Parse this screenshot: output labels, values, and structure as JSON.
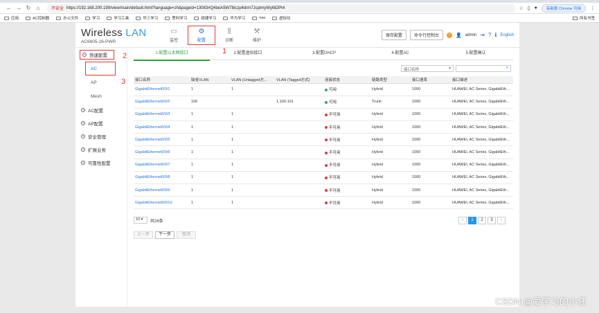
{
  "browser": {
    "insecure_label": "不安全",
    "url": "https://192.168.200.199/view/main/default.html?language=zh&pageid=13083#Q4beA5W78iczp4drm7JcpimyWyt6DPt4",
    "update_label": "有新版 Chrome 可用",
    "bookmarks": [
      "应用",
      "AC控制器",
      "办公文件",
      "学习",
      "学习工具",
      "华三学习",
      "思科学习",
      "锐捷学习",
      "华为学习",
      "nas",
      "虚拟化"
    ],
    "all_bookmarks": "所有书签"
  },
  "brand": {
    "word1": "Wireless",
    "word2": "LAN",
    "model": "AC6605-26-PWR"
  },
  "nav": [
    {
      "label": "监控",
      "icon": "monitor-icon"
    },
    {
      "label": "配置",
      "icon": "gear-icon"
    },
    {
      "label": "诊断",
      "icon": "diagnose-icon"
    },
    {
      "label": "维护",
      "icon": "maintain-icon"
    }
  ],
  "header": {
    "save": "保存配置",
    "cli": "命令行控制台",
    "user": "admin",
    "lang": "English"
  },
  "sidebar": {
    "quick": "快速配置",
    "sub": [
      "AC",
      "AP",
      "Mesh"
    ],
    "items": [
      "AC配置",
      "AP配置",
      "安全管理",
      "扩展业务",
      "可靠性配置"
    ]
  },
  "annotations": [
    "1",
    "2",
    "3"
  ],
  "steps": [
    "1.配置以太网接口",
    "2.配置虚拟接口",
    "3.配置DHCP",
    "4.配置AC",
    "5.配置确认"
  ],
  "filter": {
    "select": "接口名称",
    "search_icon": "search-icon"
  },
  "table": {
    "headers": [
      "接口名称",
      "缺省VLAN",
      "VLAN (Untagged方...",
      "VLAN (Tagged方式)",
      "连接状态",
      "链路类型",
      "接口速率",
      "接口描述"
    ],
    "rows": [
      [
        "GigabitEthernet0/0/1",
        "1",
        "1",
        "",
        "可用",
        "Hybrid",
        "1000",
        "HUAWEI, AC Series, GigabitEth..."
      ],
      [
        "GigabitEthernet0/0/2",
        "100",
        "",
        "1,100-101",
        "可用",
        "Trunk",
        "1000",
        "HUAWEI, AC Series, GigabitEth..."
      ],
      [
        "GigabitEthernet0/0/3",
        "1",
        "1",
        "",
        "不可用",
        "Hybrid",
        "1000",
        "HUAWEI, AC Series, GigabitEth..."
      ],
      [
        "GigabitEthernet0/0/4",
        "1",
        "1",
        "",
        "不可用",
        "Hybrid",
        "1000",
        "HUAWEI, AC Series, GigabitEth..."
      ],
      [
        "GigabitEthernet0/0/5",
        "1",
        "1",
        "",
        "不可用",
        "Hybrid",
        "1000",
        "HUAWEI, AC Series, GigabitEth..."
      ],
      [
        "GigabitEthernet0/0/6",
        "1",
        "1",
        "",
        "不可用",
        "Hybrid",
        "1000",
        "HUAWEI, AC Series, GigabitEth..."
      ],
      [
        "GigabitEthernet0/0/7",
        "1",
        "1",
        "",
        "不可用",
        "Hybrid",
        "1000",
        "HUAWEI, AC Series, GigabitEth..."
      ],
      [
        "GigabitEthernet0/0/8",
        "1",
        "1",
        "",
        "不可用",
        "Hybrid",
        "1000",
        "HUAWEI, AC Series, GigabitEth..."
      ],
      [
        "GigabitEthernet0/0/9",
        "1",
        "1",
        "",
        "不可用",
        "Hybrid",
        "1000",
        "HUAWEI, AC Series, GigabitEth..."
      ],
      [
        "GigabitEthernet0/0/10",
        "1",
        "1",
        "",
        "不可用",
        "Hybrid",
        "1000",
        "HUAWEI, AC Series, GigabitEth..."
      ]
    ]
  },
  "pager": {
    "page_size": "10",
    "total": "共26条",
    "pages": [
      "1",
      "2",
      "3"
    ]
  },
  "actions": {
    "prev": "上一步",
    "next": "下一步",
    "cancel": "取消"
  },
  "watermark": "CSDN @爱学习的小任",
  "colors": {
    "accent": "#1a73e8",
    "step_active": "#2e9e3e",
    "annotation": "#e53935"
  }
}
